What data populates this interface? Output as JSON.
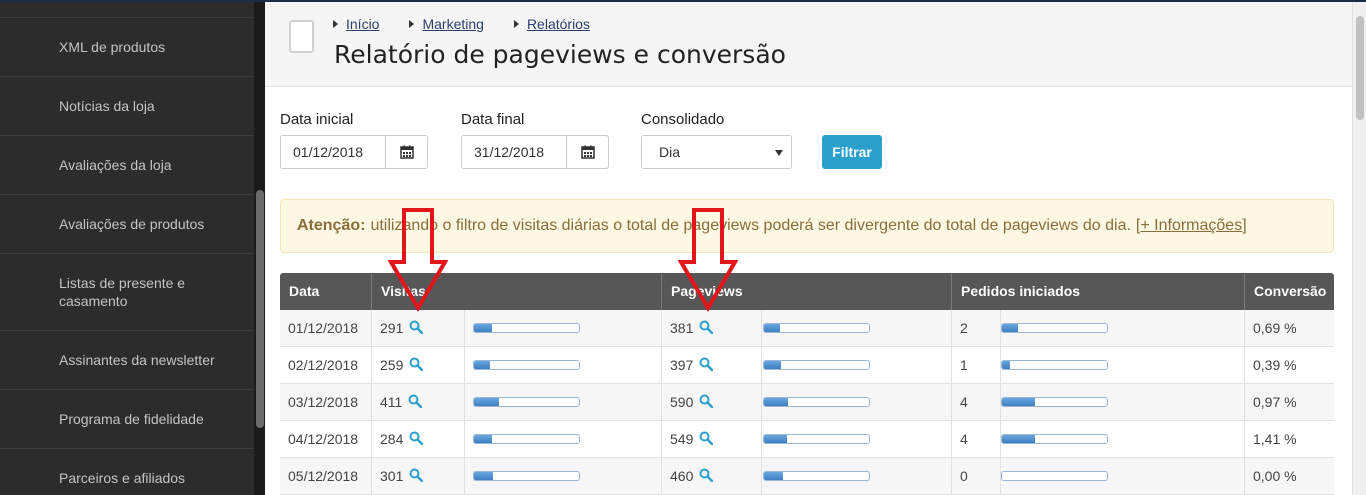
{
  "sidebar": {
    "items": [
      "XML de produtos",
      "Notícias da loja",
      "Avaliações da loja",
      "Avaliações de produtos",
      "Listas de presente e casamento",
      "Assinantes da newsletter",
      "Programa de fidelidade",
      "Parceiros e afiliados"
    ]
  },
  "breadcrumb": [
    "Início",
    "Marketing",
    "Relatórios"
  ],
  "page_title": "Relatório de pageviews e conversão",
  "filters": {
    "start_label": "Data inicial",
    "start_value": "01/12/2018",
    "end_label": "Data final",
    "end_value": "31/12/2018",
    "consolidated_label": "Consolidado",
    "consolidated_value": "Dia",
    "filter_button": "Filtrar"
  },
  "alert": {
    "strong": "Atenção:",
    "text": "utilizando o filtro de visitas diárias o total de pageviews poderá ser divergente do total de pageviews do dia.",
    "link_open": "[",
    "link": "+ Informações",
    "link_close": "]"
  },
  "table": {
    "headers": {
      "date": "Data",
      "visits": "Visitas",
      "pageviews": "Pageviews",
      "orders": "Pedidos iniciados",
      "conversion": "Conversão"
    },
    "rows": [
      {
        "date": "01/12/2018",
        "visits": "291",
        "visits_pct": 0.17,
        "pageviews": "381",
        "pageviews_pct": 0.15,
        "orders": "2",
        "orders_pct": 0.15,
        "conversion": "0,69 %"
      },
      {
        "date": "02/12/2018",
        "visits": "259",
        "visits_pct": 0.15,
        "pageviews": "397",
        "pageviews_pct": 0.16,
        "orders": "1",
        "orders_pct": 0.08,
        "conversion": "0,39 %"
      },
      {
        "date": "03/12/2018",
        "visits": "411",
        "visits_pct": 0.24,
        "pageviews": "590",
        "pageviews_pct": 0.23,
        "orders": "4",
        "orders_pct": 0.31,
        "conversion": "0,97 %"
      },
      {
        "date": "04/12/2018",
        "visits": "284",
        "visits_pct": 0.17,
        "pageviews": "549",
        "pageviews_pct": 0.22,
        "orders": "4",
        "orders_pct": 0.31,
        "conversion": "1,41 %"
      },
      {
        "date": "05/12/2018",
        "visits": "301",
        "visits_pct": 0.18,
        "pageviews": "460",
        "pageviews_pct": 0.18,
        "orders": "0",
        "orders_pct": 0.0,
        "conversion": "0,00 %"
      }
    ]
  },
  "icons": {
    "calendar": "calendar-icon",
    "search": "search-icon",
    "annotation": "red-down-arrow"
  },
  "colors": {
    "accent": "#2ca0cd",
    "annotation": "#e0161b",
    "bar_fill": "#3f7fc2"
  }
}
